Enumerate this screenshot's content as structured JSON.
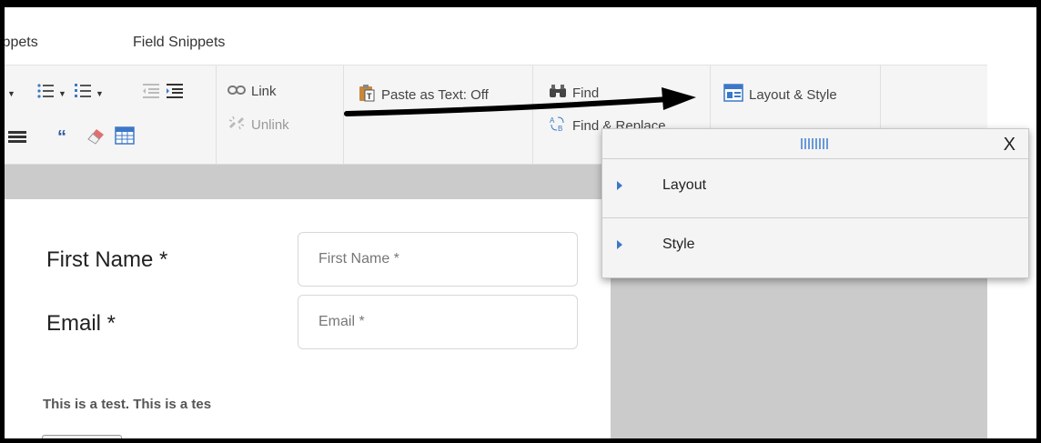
{
  "tabs": [
    "ippets",
    "Field Snippets"
  ],
  "toolbar": {
    "link_label": "Link",
    "unlink_label": "Unlink",
    "paste_label": "Paste as Text: Off",
    "find_label": "Find",
    "find_replace_label": "Find & Replace",
    "layout_style_label": "Layout & Style"
  },
  "panel": {
    "close_label": "X",
    "items": [
      "Layout",
      "Style"
    ]
  },
  "form": {
    "first_name_label": "First Name *",
    "first_name_placeholder": "First Name *",
    "email_label": "Email *",
    "email_placeholder": "Email *",
    "body_text": "This is a test. This is a tes"
  },
  "colors": {
    "toolbar_bg": "#f5f5f5",
    "gray_band": "#cbcbcb",
    "accent_blue": "#3c78c8",
    "annotation_arrow": "#000000"
  }
}
